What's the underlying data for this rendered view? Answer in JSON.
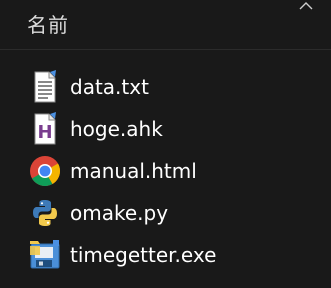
{
  "header": {
    "name_label": "名前",
    "sort_icon": "chevron-up-icon"
  },
  "files": [
    {
      "name": "data.txt",
      "icon": "text-file-icon"
    },
    {
      "name": "hoge.ahk",
      "icon": "autohotkey-file-icon"
    },
    {
      "name": "manual.html",
      "icon": "chrome-icon"
    },
    {
      "name": "omake.py",
      "icon": "python-file-icon"
    },
    {
      "name": "timegetter.exe",
      "icon": "executable-file-icon"
    }
  ],
  "colors": {
    "background": "#191919",
    "text": "#ffffff",
    "header_text": "#dcdcdc"
  }
}
